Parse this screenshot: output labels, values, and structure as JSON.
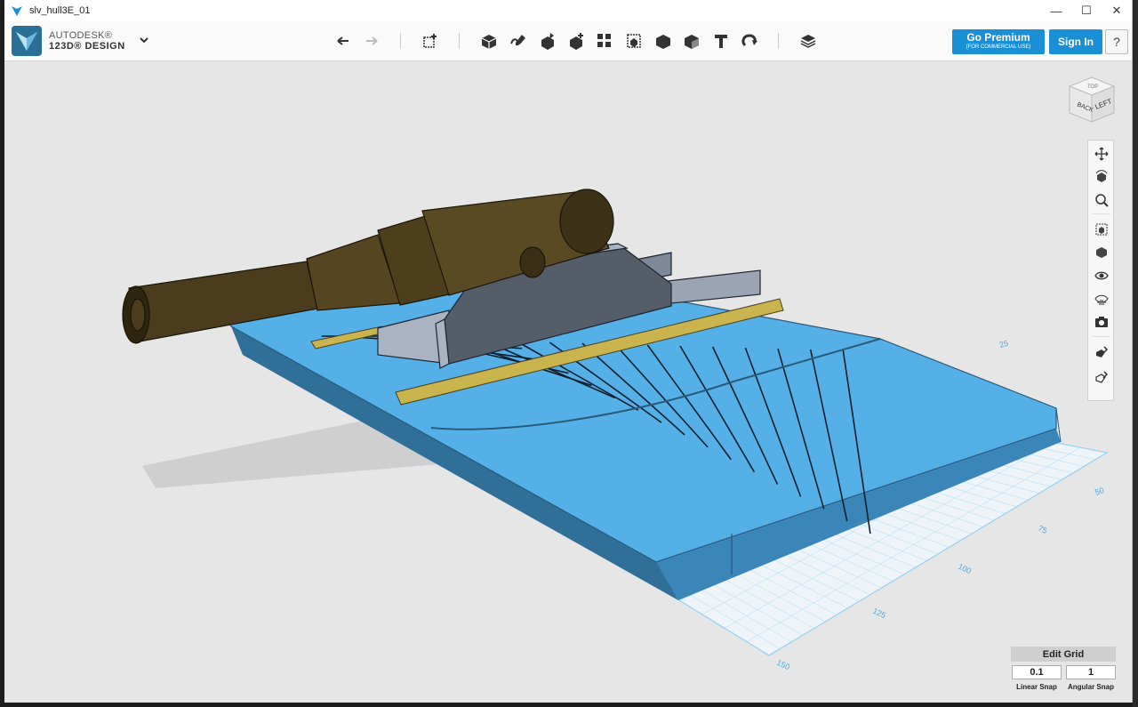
{
  "window": {
    "title": "slv_hull3E_01"
  },
  "window_controls": {
    "minimize": "—",
    "maximize": "☐",
    "close": "✕"
  },
  "brand": {
    "line1": "AUTODESK®",
    "line2": "123D® DESIGN"
  },
  "toolbar": {
    "tools": [
      "undo-icon",
      "redo-icon",
      "primitives-icon",
      "sketch-icon",
      "construct-icon",
      "modify-icon",
      "pattern-icon",
      "grouping-icon",
      "combine-icon",
      "measure-icon",
      "text-icon",
      "snap-icon",
      "material-icon"
    ]
  },
  "header_buttons": {
    "premium_label": "Go Premium",
    "premium_sub": "(FOR COMMERCIAL USE)",
    "signin_label": "Sign In",
    "help_label": "?"
  },
  "viewcube": {
    "face_left": "LEFT",
    "face_back": "BACK",
    "face_top": "TOP"
  },
  "grid": {
    "edit_label": "Edit Grid",
    "linear_snap_value": "0.1",
    "angular_snap_value": "1",
    "linear_snap_label": "Linear Snap",
    "angular_snap_label": "Angular Snap",
    "axis_labels": [
      "25",
      "50",
      "75",
      "100",
      "125",
      "150"
    ]
  },
  "colors": {
    "hull": "#55b0e8",
    "hull_side": "#3a86b9",
    "rail": "#c9b44d",
    "carriage": "#7f8899",
    "barrel": "#4a3c1d",
    "accent": "#1a8fd6"
  }
}
